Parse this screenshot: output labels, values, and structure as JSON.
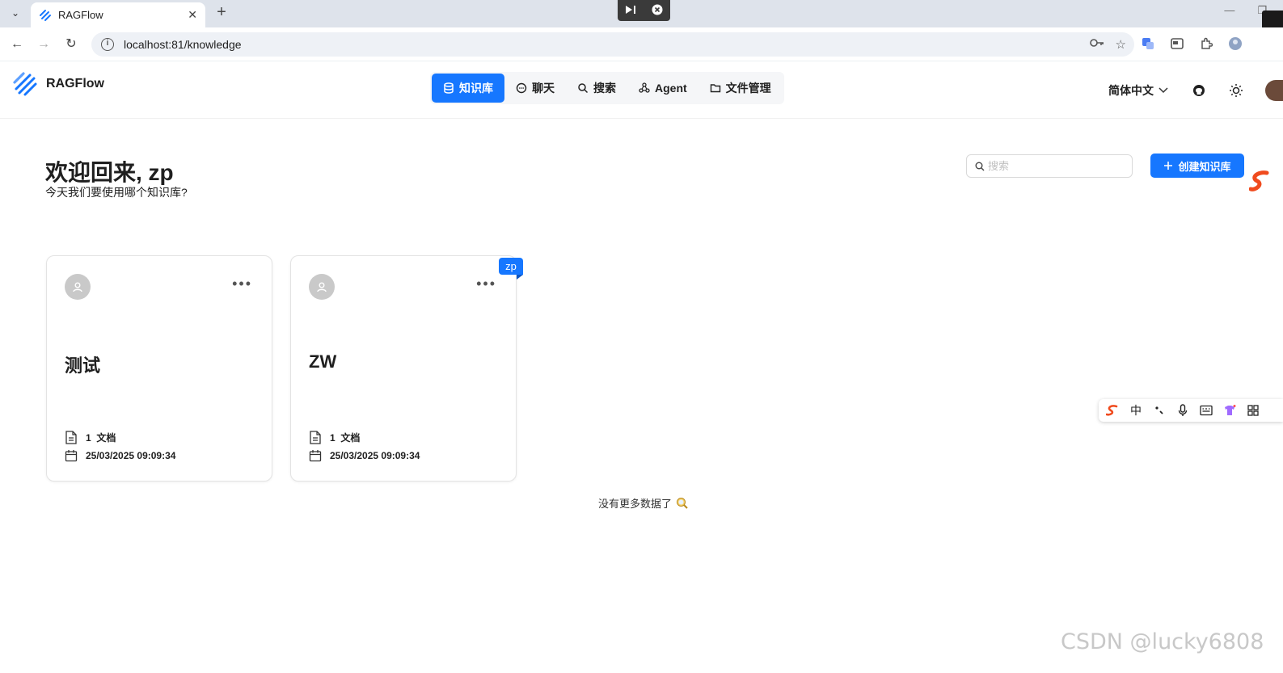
{
  "browser": {
    "tab_title": "RAGFlow",
    "tab_close": "✕",
    "new_tab": "+",
    "url": "localhost:81/knowledge"
  },
  "header": {
    "logo_text": "RAGFlow",
    "nav": [
      {
        "label": "知识库",
        "active": true
      },
      {
        "label": "聊天"
      },
      {
        "label": "搜索"
      },
      {
        "label": "Agent"
      },
      {
        "label": "文件管理"
      }
    ],
    "language": "简体中文"
  },
  "main": {
    "welcome": "欢迎回来, zp",
    "subtitle": "今天我们要使用哪个知识库?",
    "search_placeholder": "搜索",
    "create_button": "创建知识库",
    "cards": [
      {
        "name": "测试",
        "doc_count": "1",
        "doc_unit": "文档",
        "date": "25/03/2025 09:09:34"
      },
      {
        "name": "ZW",
        "doc_count": "1",
        "doc_unit": "文档",
        "date": "25/03/2025 09:09:34",
        "owner_badge": "zp"
      }
    ],
    "no_more": "没有更多数据了"
  },
  "ime": {
    "mode": "中"
  },
  "watermark": "CSDN @lucky6808",
  "colors": {
    "accent": "#1677ff",
    "tab_strip": "#dee3eb"
  }
}
